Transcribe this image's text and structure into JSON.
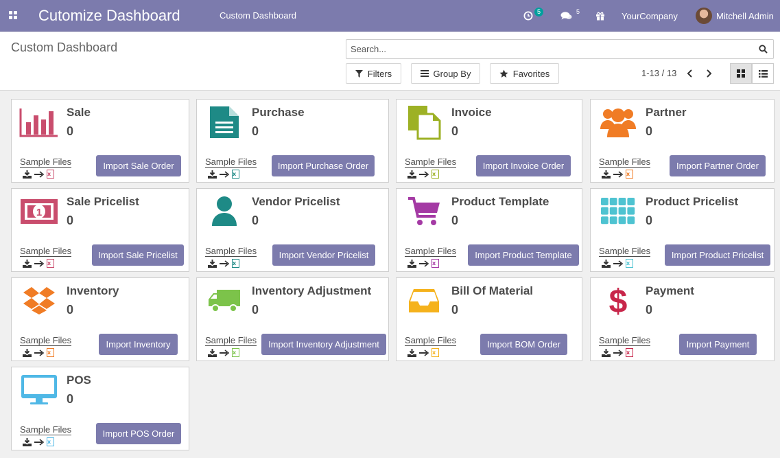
{
  "navbar": {
    "title": "Cutomize Dashboard",
    "menu_item": "Custom Dashboard",
    "activity_count": "5",
    "message_count": "5",
    "company": "YourCompany",
    "user": "Mitchell Admin"
  },
  "control": {
    "breadcrumb": "Custom Dashboard",
    "search_placeholder": "Search...",
    "filters_label": "Filters",
    "groupby_label": "Group By",
    "favorites_label": "Favorites",
    "pager": "1-13 / 13"
  },
  "colors": {
    "brand": "#7c7bad",
    "teal": "#00a09d"
  },
  "sample_label": "Sample Files",
  "cards": [
    {
      "name": "Sale",
      "count": "0",
      "button": "Import Sale Order",
      "icon": "bar-chart-icon",
      "color": "#c94d6d"
    },
    {
      "name": "Purchase",
      "count": "0",
      "button": "Import Purchase Order",
      "icon": "document-icon",
      "color": "#1e8a86"
    },
    {
      "name": "Invoice",
      "count": "0",
      "button": "Import Invoice Order",
      "icon": "copy-files-icon",
      "color": "#9db125"
    },
    {
      "name": "Partner",
      "count": "0",
      "button": "Import Partner Order",
      "icon": "users-icon",
      "color": "#f07c25"
    },
    {
      "name": "Sale Pricelist",
      "count": "0",
      "button": "Import Sale Pricelist",
      "icon": "money-bill-icon",
      "color": "#c94d6d"
    },
    {
      "name": "Vendor Pricelist",
      "count": "0",
      "button": "Import Vendor Pricelist",
      "icon": "user-icon",
      "color": "#1e8a86"
    },
    {
      "name": "Product Template",
      "count": "0",
      "button": "Import Product Template",
      "icon": "shopping-cart-icon",
      "color": "#a43aa4"
    },
    {
      "name": "Product Pricelist",
      "count": "0",
      "button": "Import Product Pricelist",
      "icon": "grid-icon",
      "color": "#4ec3d1"
    },
    {
      "name": "Inventory",
      "count": "0",
      "button": "Import Inventory",
      "icon": "dropbox-icon",
      "color": "#f07c25"
    },
    {
      "name": "Inventory Adjustment",
      "count": "0",
      "button": "Import Inventory Adjustment",
      "icon": "truck-icon",
      "color": "#7cc34a"
    },
    {
      "name": "Bill Of Material",
      "count": "0",
      "button": "Import BOM Order",
      "icon": "inbox-icon",
      "color": "#f5b21c"
    },
    {
      "name": "Payment",
      "count": "0",
      "button": "Import Payment",
      "icon": "dollar-icon",
      "color": "#c8264a"
    },
    {
      "name": "POS",
      "count": "0",
      "button": "Import POS Order",
      "icon": "monitor-icon",
      "color": "#4fb8e6"
    }
  ]
}
